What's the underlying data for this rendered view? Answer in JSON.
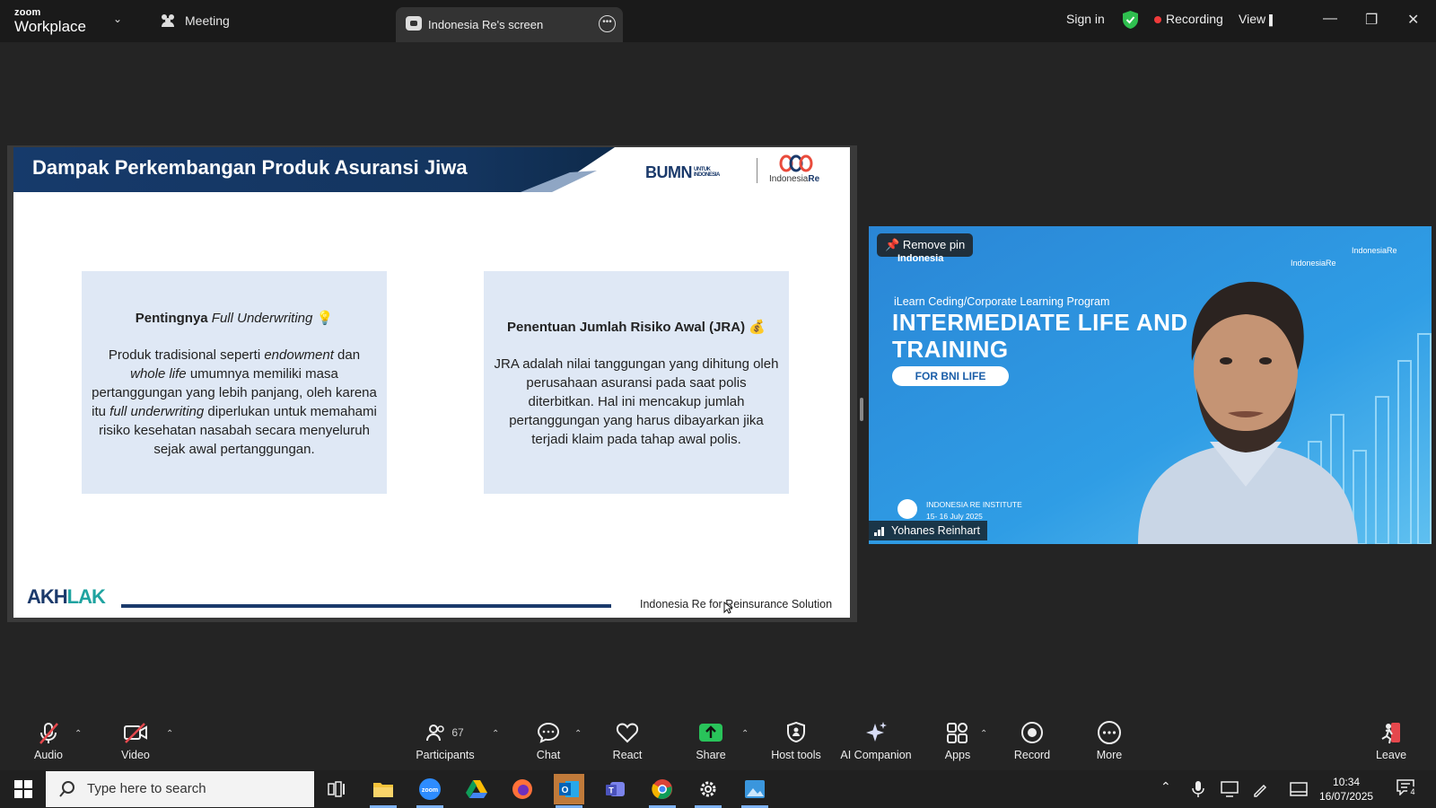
{
  "titlebar": {
    "brand_top": "zoom",
    "brand_bottom": "Workplace",
    "meeting_label": "Meeting",
    "share_tab_label": "Indonesia Re's screen",
    "sign_in": "Sign in",
    "recording": "Recording",
    "view": "View"
  },
  "slide": {
    "title": "Dampak Perkembangan Produk Asuransi Jiwa",
    "logo_bumn": "BUMN",
    "logo_bumn_sub": "UNTUK INDONESIA",
    "logo_ire_a": "Indonesia",
    "logo_ire_b": "Re",
    "card1": {
      "title_a": "Pentingnya ",
      "title_b": "Full Underwriting",
      "body_1": "Produk tradisional seperti ",
      "body_2": "endowment",
      "body_3": " dan ",
      "body_4": "whole life",
      "body_5": " umumnya memiliki masa pertanggungan yang lebih panjang, oleh karena itu ",
      "body_6": "full underwriting",
      "body_7": " diperlukan untuk memahami risiko kesehatan nasabah secara menyeluruh sejak awal pertanggungan."
    },
    "card2": {
      "title": "Penentuan Jumlah Risiko Awal (JRA)",
      "body": "JRA adalah nilai tanggungan yang dihitung oleh perusahaan asuransi pada saat polis diterbitkan. Hal ini mencakup jumlah pertanggungan yang harus dibayarkan jika terjadi klaim pada tahap awal polis."
    },
    "footer_logo_a": "AKH",
    "footer_logo_b": "LAK",
    "footer_text": "Indonesia Re for Reinsurance Solution"
  },
  "video": {
    "remove_pin": "Remove pin",
    "bg_indonesia": "Indonesia",
    "bg_logo_ire": "IndonesiaRe",
    "bg_logo_institute": "IndonesiaRe",
    "bg_program": "iLearn Ceding/Corporate Learning Program",
    "bg_big1": "INTERMEDIATE LIFE AND",
    "bg_big2": "TRAINING",
    "bg_pill": "FOR BNI LIFE",
    "bg_inst": "INDONESIA RE INSTITUTE",
    "bg_date": "15- 16 July 2025",
    "name": "Yohanes Reinhart"
  },
  "toolbar": {
    "audio": "Audio",
    "video": "Video",
    "participants": "Participants",
    "participants_count": "67",
    "chat": "Chat",
    "react": "React",
    "share": "Share",
    "host_tools": "Host tools",
    "ai_companion": "AI Companion",
    "apps": "Apps",
    "record": "Record",
    "more": "More",
    "leave": "Leave"
  },
  "taskbar": {
    "search_placeholder": "Type here to search",
    "time": "10:34",
    "date": "16/07/2025",
    "notification_count": "4"
  },
  "colors": {
    "slide_navy": "#1b3a6b",
    "recording_red": "#ef3b3b",
    "shield_green": "#2fbf4f",
    "share_green": "#29c35a",
    "card_bg": "#dfe8f5"
  }
}
